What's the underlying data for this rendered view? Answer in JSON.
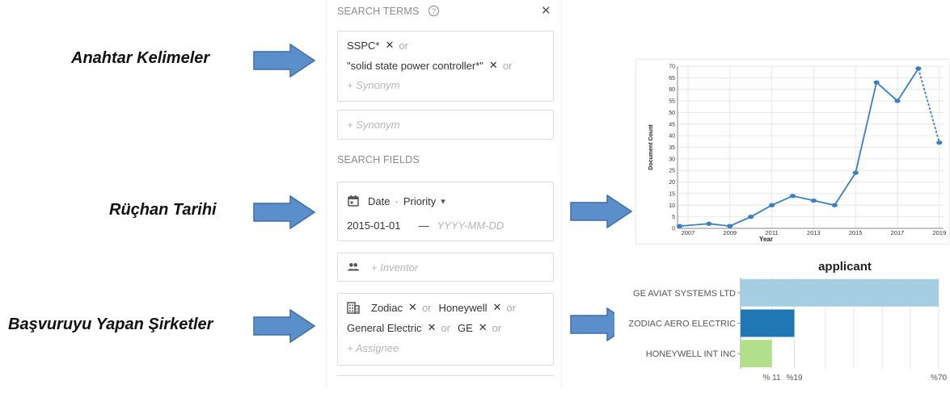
{
  "labels": {
    "keywords": "Anahtar Kelimeler",
    "priority_date": "Rüçhan Tarihi",
    "applicants": "Başvuruyu Yapan Şirketler"
  },
  "search_terms": {
    "title": "SEARCH TERMS",
    "help_icon": "help-circle-icon",
    "close_label": "✕",
    "terms": [
      "SSPC*",
      "\"solid state power controller*\""
    ],
    "or_label": "or",
    "chip_remove": "✕",
    "synonym_placeholder": "+ Synonym",
    "empty_synonym_placeholder": "+ Synonym"
  },
  "search_fields": {
    "title": "SEARCH FIELDS",
    "date_label": "Date",
    "separator": "·",
    "date_type": "Priority",
    "dropdown_icon": "▾",
    "date_from": "2015-01-01",
    "date_dash": "—",
    "date_to_placeholder": "YYYY-MM-DD",
    "inventor_placeholder": "+ Inventor",
    "assignees": [
      "Zodiac",
      "Honeywell",
      "General Electric",
      "GE"
    ],
    "assignee_placeholder": "+ Assignee"
  },
  "colors": {
    "arrow_fill": "#5b8fcb",
    "arrow_stroke": "#3f6fa3",
    "line": "#3a7fc1",
    "bar_ge": "#a6cee3",
    "bar_zodiac": "#1f78b4",
    "bar_honeywell": "#b2df8a"
  },
  "chart_data": [
    {
      "type": "line",
      "title": "",
      "xlabel": "Year",
      "ylabel": "Document Count",
      "x_ticks": [
        "2007",
        "2009",
        "2011",
        "2013",
        "2015",
        "2017",
        "2019"
      ],
      "y_ticks": [
        "0",
        "5",
        "10",
        "15",
        "20",
        "25",
        "30",
        "35",
        "40",
        "45",
        "50",
        "55",
        "60",
        "65",
        "70"
      ],
      "ylim": [
        0,
        70
      ],
      "xlim": [
        2006.5,
        2019.2
      ],
      "x": [
        2006.6,
        2008,
        2009,
        2010,
        2011,
        2012,
        2013,
        2014,
        2015,
        2016,
        2017,
        2018,
        2019
      ],
      "values": [
        1,
        2,
        1,
        5,
        10,
        14,
        12,
        10,
        24,
        63,
        55,
        69,
        37
      ],
      "dashed_last_segment": true,
      "grid": true
    },
    {
      "type": "bar",
      "orientation": "horizontal",
      "title": "applicant",
      "categories": [
        "GE AVIAT SYSTEMS LTD",
        "ZODIAC AERO ELECTRIC",
        "HONEYWELL INT INC"
      ],
      "values": [
        70,
        19,
        11
      ],
      "tick_labels": [
        "% 11",
        "%19",
        "%70"
      ],
      "tick_values": [
        11,
        19,
        70
      ],
      "xlim": [
        0,
        72
      ],
      "grid": true
    }
  ]
}
